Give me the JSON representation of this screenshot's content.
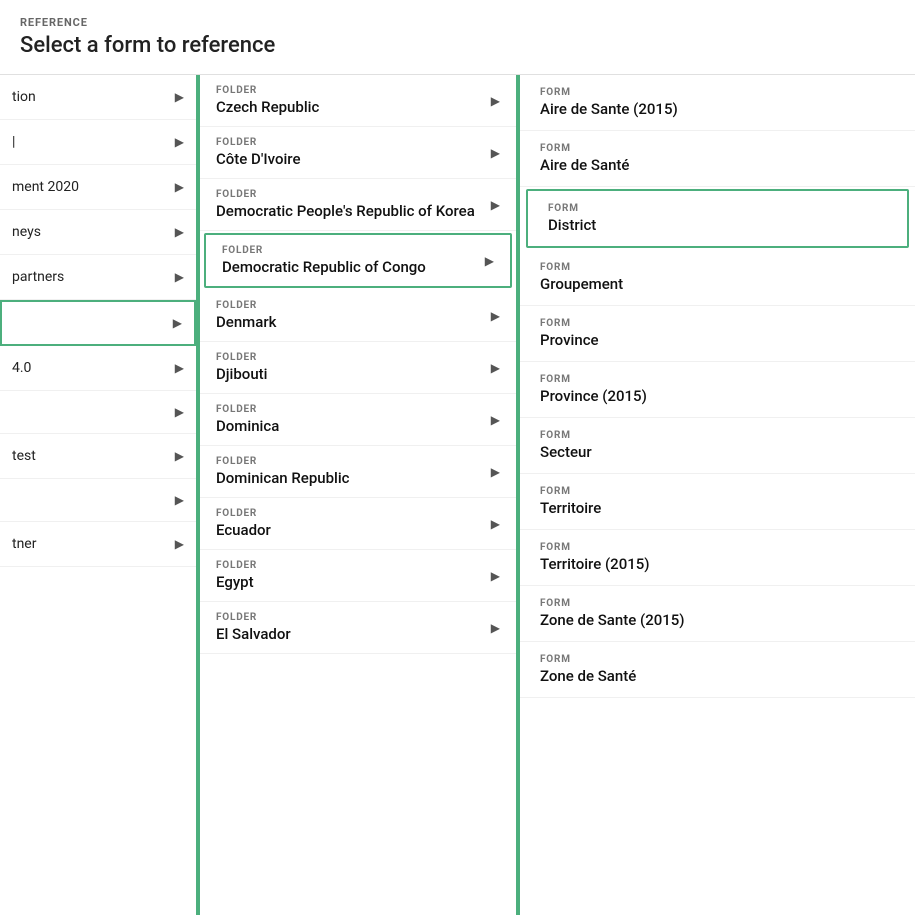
{
  "header": {
    "reference_label": "REFERENCE",
    "select_title": "Select a form to reference"
  },
  "left_items": [
    {
      "id": "tion",
      "label": "tion",
      "active": false
    },
    {
      "id": "pipe",
      "label": "|",
      "active": false
    },
    {
      "id": "ment2020",
      "label": "ment 2020",
      "active": false
    },
    {
      "id": "neys",
      "label": "neys",
      "active": false
    },
    {
      "id": "partners",
      "label": "partners",
      "active": false
    },
    {
      "id": "active-item",
      "label": "",
      "active": true
    },
    {
      "id": "4-0",
      "label": "4.0",
      "active": false
    },
    {
      "id": "blank",
      "label": "",
      "active": false
    },
    {
      "id": "test",
      "label": "test",
      "active": false
    },
    {
      "id": "blank2",
      "label": "",
      "active": false
    },
    {
      "id": "tner",
      "label": "tner",
      "active": false
    }
  ],
  "folders": [
    {
      "id": "czech-republic",
      "label": "FOLDER",
      "name": "Czech Republic",
      "selected": false
    },
    {
      "id": "cote-divoire",
      "label": "FOLDER",
      "name": "Côte D'Ivoire",
      "selected": false
    },
    {
      "id": "dprk",
      "label": "FOLDER",
      "name": "Democratic People's Republic of Korea",
      "selected": false
    },
    {
      "id": "drc",
      "label": "FOLDER",
      "name": "Democratic Republic of Congo",
      "selected": true
    },
    {
      "id": "denmark",
      "label": "FOLDER",
      "name": "Denmark",
      "selected": false
    },
    {
      "id": "djibouti",
      "label": "FOLDER",
      "name": "Djibouti",
      "selected": false
    },
    {
      "id": "dominica",
      "label": "FOLDER",
      "name": "Dominica",
      "selected": false
    },
    {
      "id": "dominican-republic",
      "label": "FOLDER",
      "name": "Dominican Republic",
      "selected": false
    },
    {
      "id": "ecuador",
      "label": "FOLDER",
      "name": "Ecuador",
      "selected": false
    },
    {
      "id": "egypt",
      "label": "FOLDER",
      "name": "Egypt",
      "selected": false
    },
    {
      "id": "el-salvador",
      "label": "FOLDER",
      "name": "El Salvador",
      "selected": false
    }
  ],
  "forms": [
    {
      "id": "aire-sante-2015",
      "label": "FORM",
      "name": "Aire de Sante (2015)",
      "selected": false
    },
    {
      "id": "aire-sante",
      "label": "FORM",
      "name": "Aire de Santé",
      "selected": false
    },
    {
      "id": "district",
      "label": "FORM",
      "name": "District",
      "selected": true
    },
    {
      "id": "groupement",
      "label": "FORM",
      "name": "Groupement",
      "selected": false
    },
    {
      "id": "province",
      "label": "FORM",
      "name": "Province",
      "selected": false
    },
    {
      "id": "province-2015",
      "label": "FORM",
      "name": "Province (2015)",
      "selected": false
    },
    {
      "id": "secteur",
      "label": "FORM",
      "name": "Secteur",
      "selected": false
    },
    {
      "id": "territoire",
      "label": "FORM",
      "name": "Territoire",
      "selected": false
    },
    {
      "id": "territoire-2015",
      "label": "FORM",
      "name": "Territoire (2015)",
      "selected": false
    },
    {
      "id": "zone-sante-2015",
      "label": "FORM",
      "name": "Zone de Sante (2015)",
      "selected": false
    },
    {
      "id": "zone-sante",
      "label": "FORM",
      "name": "Zone de Santé",
      "selected": false
    }
  ],
  "icons": {
    "chevron_right": "▶"
  },
  "colors": {
    "accent": "#4caf7d",
    "selected_border": "#4caf7d",
    "folder_label": "#777",
    "text_primary": "#111"
  }
}
